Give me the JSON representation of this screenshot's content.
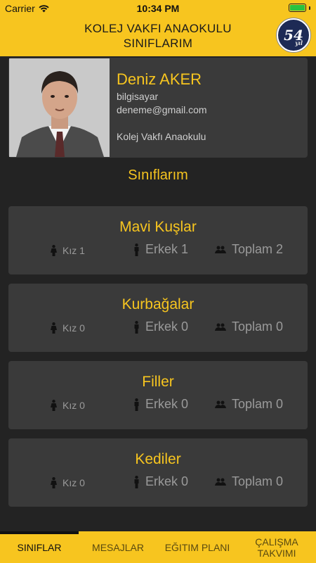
{
  "status_bar": {
    "carrier": "Carrier",
    "time": "10:34 PM"
  },
  "header": {
    "title_line1": "KOLEJ VAKFI ANAOKULU",
    "title_line2": "SINIFLARIM",
    "logo_text": "54",
    "logo_subtext": "yıl"
  },
  "profile": {
    "name": "Deniz AKER",
    "role": "bilgisayar",
    "email": "deneme@gmail.com",
    "school": "Kolej Vakfı Anaokulu"
  },
  "section_title": "Sınıflarım",
  "classes": [
    {
      "name": "Mavi Kuşlar",
      "girls": "Kız 1",
      "boys": "Erkek 1",
      "total": "Toplam 2"
    },
    {
      "name": "Kurbağalar",
      "girls": "Kız 0",
      "boys": "Erkek 0",
      "total": "Toplam 0"
    },
    {
      "name": "Filler",
      "girls": "Kız 0",
      "boys": "Erkek 0",
      "total": "Toplam 0"
    },
    {
      "name": "Kediler",
      "girls": "Kız 0",
      "boys": "Erkek 0",
      "total": "Toplam 0"
    }
  ],
  "tabs": [
    {
      "label": "SINIFLAR",
      "active": true
    },
    {
      "label": "MESAJLAR",
      "active": false
    },
    {
      "label": "EĞITIM PLANI",
      "active": false
    },
    {
      "label_line1": "ÇALIŞMA",
      "label_line2": "TAKVIMI",
      "active": false
    }
  ],
  "colors": {
    "accent": "#F7C51F",
    "background": "#232323",
    "card": "#3A3A3A",
    "muted_text": "#9a9a9a"
  }
}
